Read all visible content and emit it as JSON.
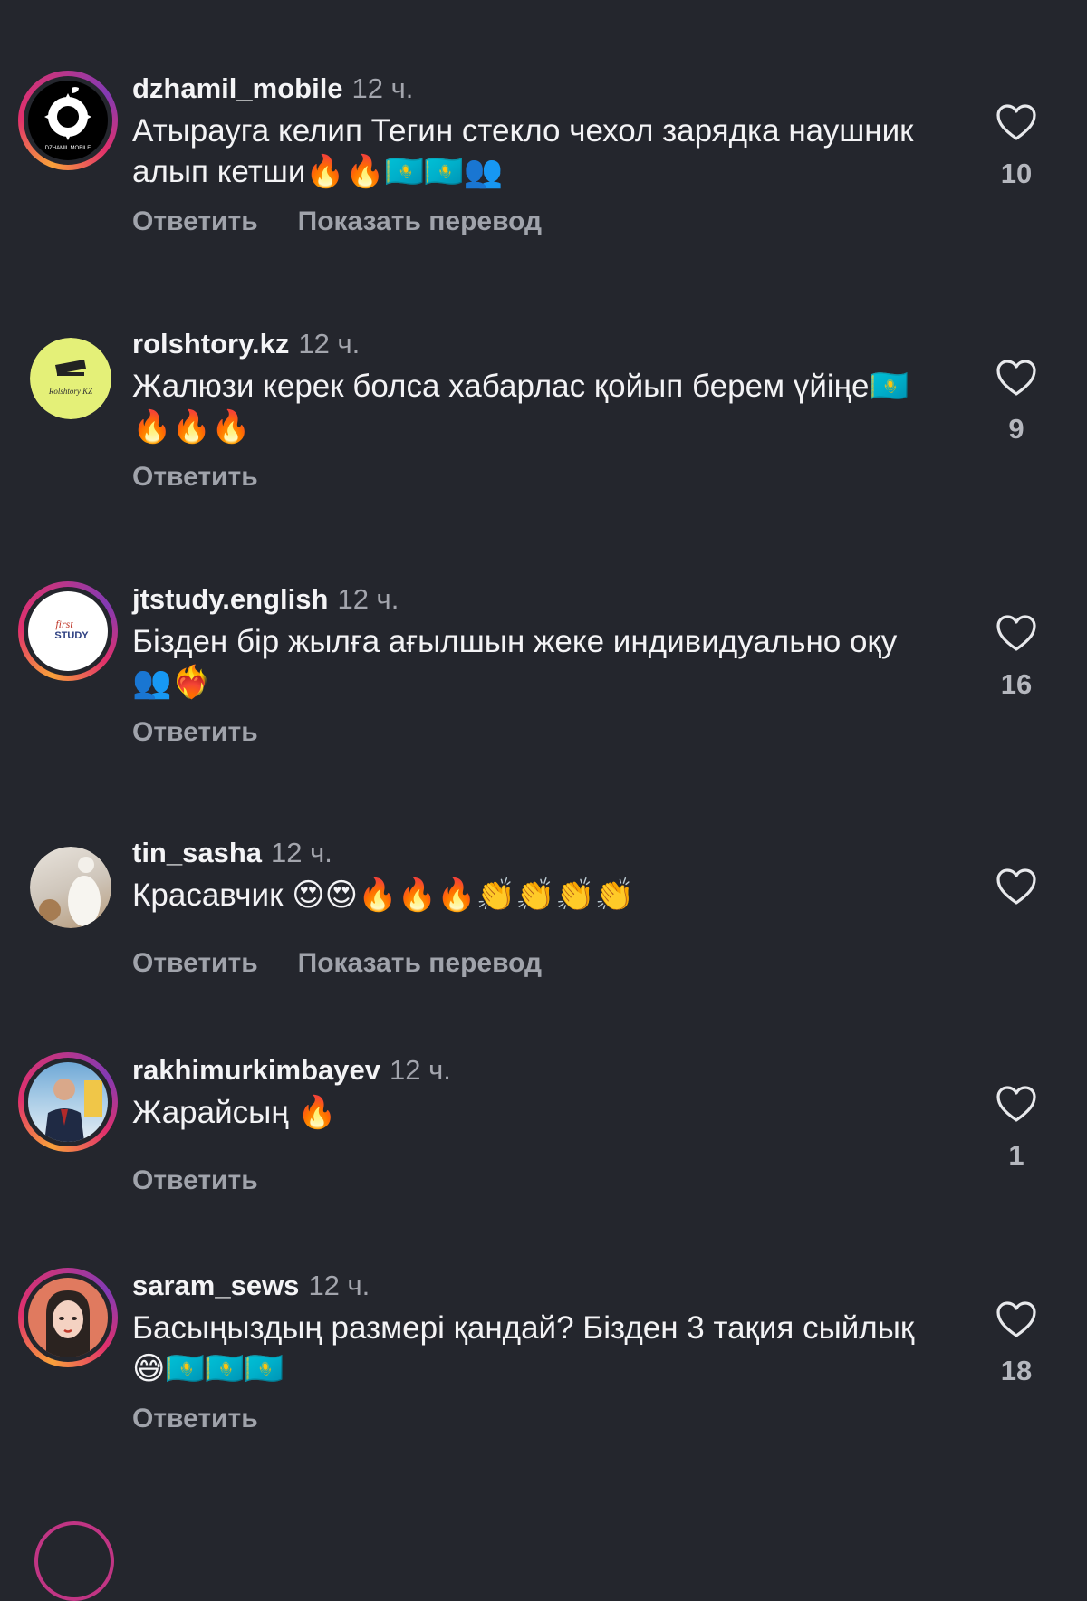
{
  "comments": [
    {
      "username": "dzhamil_mobile",
      "time": "12 ч.",
      "text": "Атырауга келип Тегин стекло чехол зарядка наушник алып кетши🔥🔥🇰🇿🇰🇿👥",
      "reply_label": "Ответить",
      "translate_label": "Показать перевод",
      "likes": "10",
      "avatar_icon": "apple-gear-logo-icon",
      "avatar_caption": "DZHAMIL MOBILE"
    },
    {
      "username": "rolshtory.kz",
      "time": "12 ч.",
      "text": "Жалюзи керек болса хабарлас қойып берем үйіңе🇰🇿🔥🔥🔥",
      "reply_label": "Ответить",
      "likes": "9",
      "avatar_icon": "blinds-logo-icon",
      "avatar_caption": "Rolshtory KZ"
    },
    {
      "username": "jtstudy.english",
      "time": "12 ч.",
      "text": "Бізден бір жылға ағылшын жеке индивидуально оқу👥❤️‍🔥",
      "reply_label": "Ответить",
      "likes": "16",
      "avatar_icon": "study-logo-icon",
      "avatar_caption": "STUDY"
    },
    {
      "username": "tin_sasha",
      "time": "12 ч.",
      "text": "Красавчик 😍😍🔥🔥🔥👏👏👏👏",
      "reply_label": "Ответить",
      "translate_label": "Показать перевод",
      "likes": "",
      "avatar_icon": "photo-avatar-icon"
    },
    {
      "username": "rakhimurkimbayev",
      "time": "12 ч.",
      "text": "Жарайсың 🔥",
      "reply_label": "Ответить",
      "likes": "1",
      "avatar_icon": "photo-avatar-icon"
    },
    {
      "username": "saram_sews",
      "time": "12 ч.",
      "text": "Басыңыздың размері қандай? Бізден 3 тақия сыйлық 😅🇰🇿🇰🇿🇰🇿",
      "reply_label": "Ответить",
      "likes": "18",
      "avatar_icon": "illustrated-avatar-icon"
    }
  ],
  "colors": {
    "background": "#24262d",
    "username": "#f4f4f6",
    "secondary": "#a0a3ab",
    "story_ring": "#e1306c"
  }
}
